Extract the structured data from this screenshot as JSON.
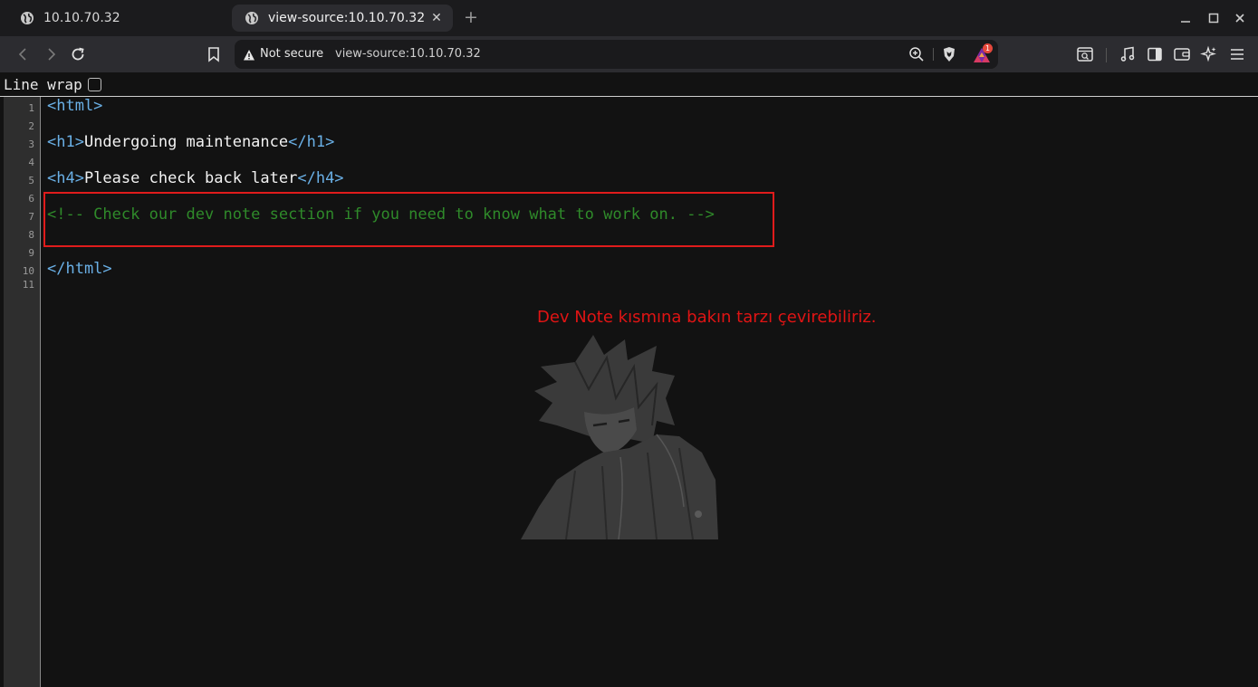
{
  "tabs": [
    {
      "title": "10.10.70.32",
      "active": false
    },
    {
      "title": "view-source:10.10.70.32",
      "active": true
    }
  ],
  "toolbar": {
    "security_label": "Not secure",
    "url": "view-source:10.10.70.32",
    "rewards_badge": "1"
  },
  "viewer": {
    "line_wrap_label": "Line wrap",
    "line_wrap_checked": false,
    "line_numbers": [
      "1",
      "2",
      "3",
      "4",
      "5",
      "6",
      "7",
      "8",
      "9",
      "10",
      "11"
    ],
    "lines": {
      "l1_tag": "<html>",
      "l3_open": "<h1>",
      "l3_text": "Undergoing maintenance",
      "l3_close": "</h1>",
      "l5_open": "<h4>",
      "l5_text": "Please check back later",
      "l5_close": "</h4>",
      "l7_comment": "<!-- Check our dev note section if you need to know what to work on. -->",
      "l10_tag": "</html>"
    }
  },
  "annotation": {
    "text": "Dev Note kısmına bakın tarzı çevirebiliriz.",
    "color": "#e01414"
  },
  "colors": {
    "tag": "#6ab0e6",
    "comment": "#2f8a2a",
    "highlight_box": "#e01b1b"
  }
}
